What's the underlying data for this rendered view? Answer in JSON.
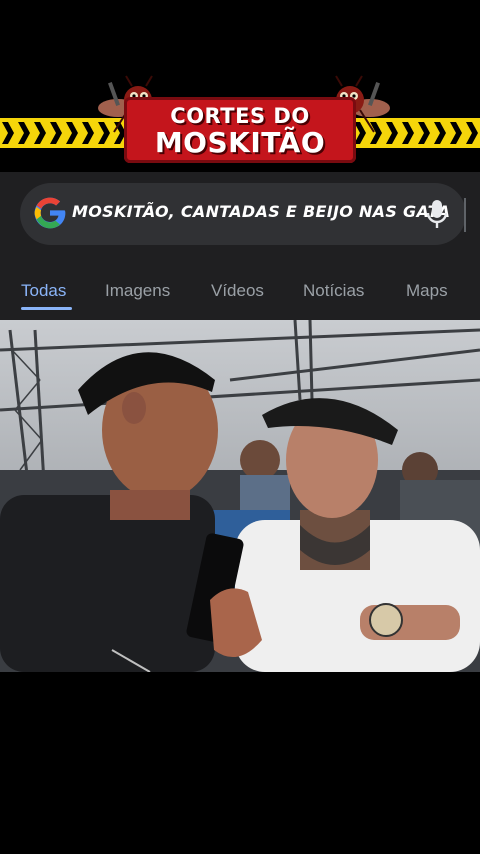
{
  "banner": {
    "line1": "CORTES DO",
    "line2": "MOSKITÃO"
  },
  "search": {
    "query": "MOSKITÃO, CANTADAS E BEIJO NAS GATA"
  },
  "tabs": [
    {
      "label": "Todas",
      "active": true
    },
    {
      "label": "Imagens",
      "active": false
    },
    {
      "label": "Vídeos",
      "active": false
    },
    {
      "label": "Notícias",
      "active": false
    },
    {
      "label": "Maps",
      "active": false
    }
  ],
  "colors": {
    "brand_red": "#c4151c",
    "stripe_yellow": "#f5d50a",
    "search_panel": "#1f1f21",
    "search_box": "#303134",
    "tab_active": "#8ab4f8",
    "tab_inactive": "#9aa0a6"
  },
  "icons": {
    "google": "google-g-icon",
    "mic": "mic-icon"
  }
}
